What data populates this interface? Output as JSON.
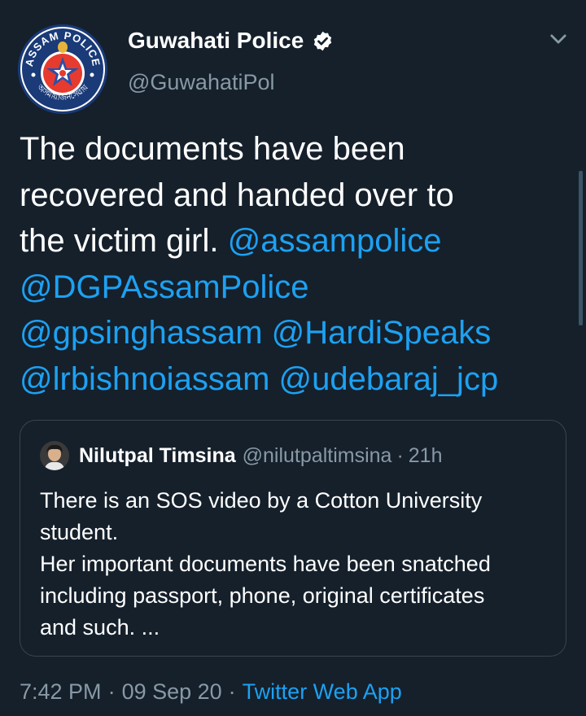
{
  "author": {
    "display_name": "Guwahati Police",
    "handle": "@GuwahatiPol",
    "avatar_icon": "assam-police-emblem",
    "avatar_text_top": "ASSAM POLICE",
    "avatar_text_bottom": "অসমীয়াজনসেৱায়",
    "verified_icon": "verified-badge-icon"
  },
  "tweet": {
    "text_lines": [
      "The documents have been",
      "recovered and handed over to",
      "the victim girl."
    ],
    "mentions": [
      "@assampolice",
      "@DGPAssamPolice",
      "@gpsinghassam",
      "@HardiSpeaks",
      "@lrbishnoiassam",
      "@udebaraj_jcp"
    ]
  },
  "quoted_tweet": {
    "display_name": "Nilutpal Timsina",
    "handle": "@nilutpaltimsina",
    "separator": "·",
    "time": "21h",
    "text_lines": [
      "There is an SOS video by a Cotton University",
      "student.",
      "Her important documents have been snatched",
      "including passport, phone, original certificates",
      "and such. ..."
    ]
  },
  "meta": {
    "time": "7:42 PM",
    "separator": "·",
    "date": "09 Sep 20",
    "source": "Twitter Web App"
  },
  "colors": {
    "background": "#15202b",
    "accent": "#1da1f2",
    "secondary_text": "#8899a6",
    "border": "#38444d"
  }
}
